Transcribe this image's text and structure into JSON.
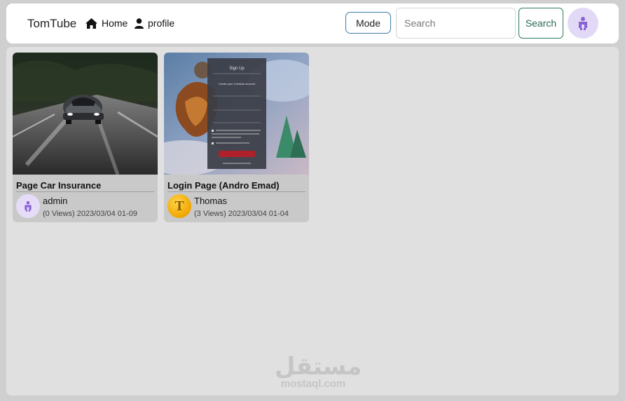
{
  "navbar": {
    "brand": "TomTube",
    "links": [
      {
        "label": "Home",
        "icon": "home-icon"
      },
      {
        "label": "profile",
        "icon": "user-icon"
      }
    ],
    "mode_label": "Mode",
    "search": {
      "placeholder": "Search",
      "value": ""
    },
    "search_label": "Search",
    "avatar_icon": "user-avatar-icon"
  },
  "videos": [
    {
      "title": "Page Car Insurance",
      "author": "admin",
      "meta": "(0 Views) 2023/03/04 01-09",
      "thumbnail": "car-night-road"
    },
    {
      "title": "Login Page (Andro Emad)",
      "author": "Thomas",
      "author_initial": "T",
      "meta": "(3 Views) 2023/03/04 01-04",
      "thumbnail": "signup-form-fantasy"
    }
  ],
  "thumbnail_texts": {
    "form_title": "Sign Up",
    "form_subtitle": "Create your Cheddar account"
  },
  "watermark": {
    "arabic": "مستقل",
    "latin": "mostaql.com"
  },
  "colors": {
    "accent_purple": "#8a63d2",
    "search_border": "#2f7a62",
    "mode_border": "#3d7ba8"
  }
}
